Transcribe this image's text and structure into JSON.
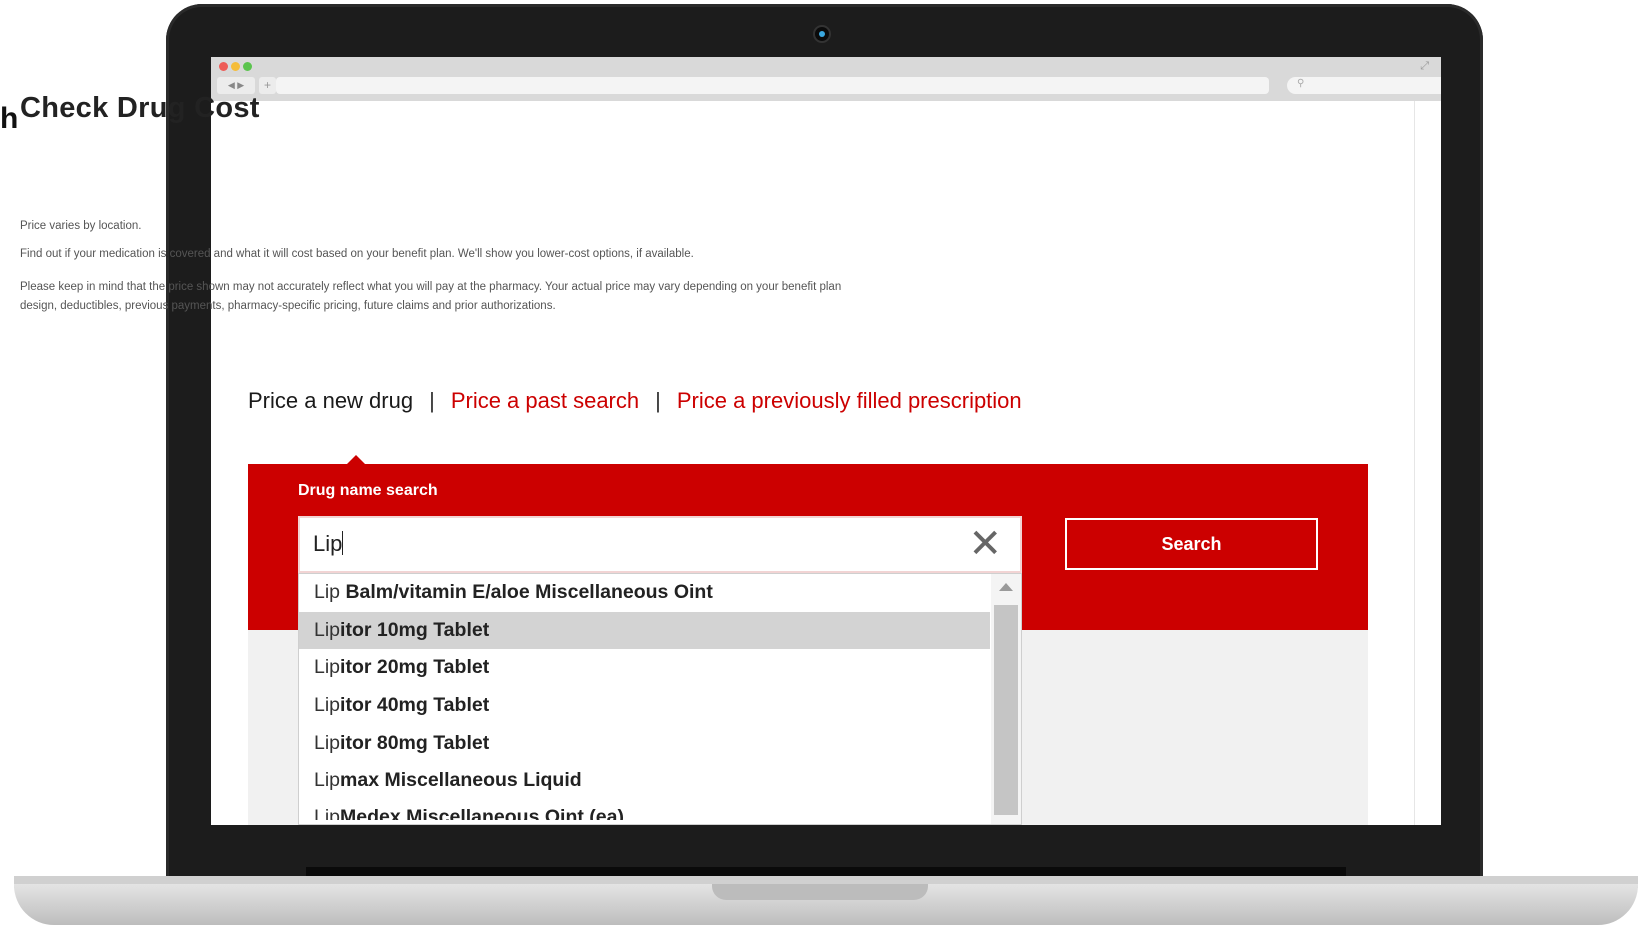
{
  "edge_fragment": "h",
  "browser": {
    "nav_buttons": "◀ ▶",
    "newtab": "+"
  },
  "page": {
    "title": "Check Drug Cost",
    "intro": [
      "Price varies by location.",
      "Find out if your medication is covered and what it will cost based on your benefit plan. We'll show you lower-cost options, if available.",
      "Please keep in mind that the price shown may not accurately reflect what you will pay at the pharmacy. Your actual price may vary depending on your benefit plan design, deductibles, previous payments, pharmacy-specific pricing, future claims and prior authorizations."
    ],
    "tabs": {
      "new_drug": "Price a new drug",
      "past_search": "Price a past search",
      "previous_prescription": "Price a previously filled prescription",
      "separator": "|"
    },
    "search": {
      "label": "Drug name search",
      "value": "Lip",
      "button": "Search"
    },
    "suggestions": [
      {
        "prefix": "Lip",
        "rest": " Balm/vitamin E/aloe Miscellaneous Oint"
      },
      {
        "prefix": "Lip",
        "rest": "itor 10mg Tablet"
      },
      {
        "prefix": "Lip",
        "rest": "itor 20mg Tablet"
      },
      {
        "prefix": "Lip",
        "rest": "itor 40mg Tablet"
      },
      {
        "prefix": "Lip",
        "rest": "itor 80mg Tablet"
      },
      {
        "prefix": "Lip",
        "rest": "max Miscellaneous Liquid"
      },
      {
        "prefix": "Lip",
        "rest": "Medex Miscellaneous Oint (ea)"
      }
    ],
    "highlighted_index": 1
  },
  "colors": {
    "brand_red": "#cc0000",
    "highlight": "#d3d3d3"
  },
  "icons": {
    "clear": "close-icon",
    "scroll_up": "chevron-up-icon",
    "search_bar": "search-icon"
  }
}
